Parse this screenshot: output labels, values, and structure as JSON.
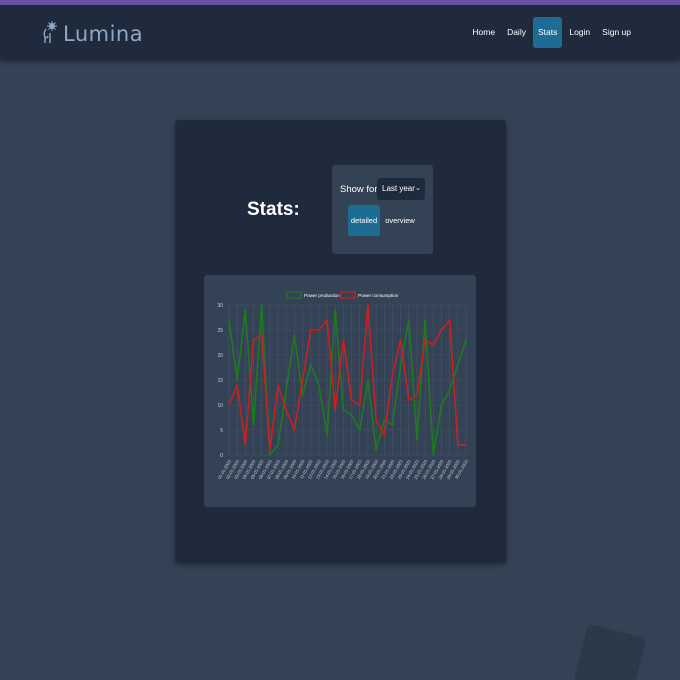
{
  "nav": {
    "brand": "Lumina",
    "links": [
      {
        "label": "Home",
        "active": false
      },
      {
        "label": "Daily",
        "active": false
      },
      {
        "label": "Stats",
        "active": true
      },
      {
        "label": "Login",
        "active": false
      },
      {
        "label": "Sign up",
        "active": false
      }
    ]
  },
  "stats": {
    "title": "Stats:",
    "show_for_label": "Show for:",
    "period_selected": "Last year",
    "detailed_label": "detailed",
    "overview_label": "overview"
  },
  "colors": {
    "production": "#1e7a1e",
    "consumption": "#cc1f1f",
    "accent": "#1e6b94"
  },
  "chart_data": {
    "type": "line",
    "title": "",
    "xlabel": "",
    "ylabel": "",
    "ylim": [
      0,
      30
    ],
    "yticks": [
      0,
      5,
      10,
      15,
      20,
      25,
      30
    ],
    "grid": true,
    "legend_position": "top",
    "categories": [
      "01-01-2023",
      "02-01-2023",
      "03-01-2023",
      "04-01-2023",
      "05-01-2023",
      "06-01-2023",
      "07-01-2023",
      "08-01-2023",
      "09-01-2023",
      "10-01-2023",
      "11-01-2023",
      "12-01-2023",
      "13-01-2023",
      "14-01-2023",
      "15-01-2023",
      "16-01-2023",
      "17-01-2023",
      "18-01-2023",
      "19-01-2023",
      "20-01-2023",
      "21-01-2023",
      "22-01-2023",
      "23-01-2023",
      "24-01-2023",
      "25-01-2023",
      "26-01-2023",
      "27-01-2023",
      "28-01-2023",
      "29-01-2023",
      "30-01-2023"
    ],
    "series": [
      {
        "name": "Power production",
        "color": "#1e7a1e",
        "values": [
          27,
          15,
          29,
          6,
          30,
          0,
          2,
          13,
          24,
          12,
          18,
          14,
          4,
          29,
          9,
          8,
          5,
          15,
          1,
          7,
          6,
          18,
          27,
          3,
          27,
          0,
          10,
          13,
          18,
          23
        ]
      },
      {
        "name": "Power consumption",
        "color": "#cc1f1f",
        "values": [
          10,
          14,
          2,
          23,
          24,
          1,
          14,
          9,
          5,
          15,
          25,
          25,
          27,
          9,
          23,
          11,
          10,
          30,
          7,
          4,
          16,
          23,
          11,
          12,
          23,
          22,
          25,
          27,
          2,
          2
        ]
      }
    ]
  }
}
